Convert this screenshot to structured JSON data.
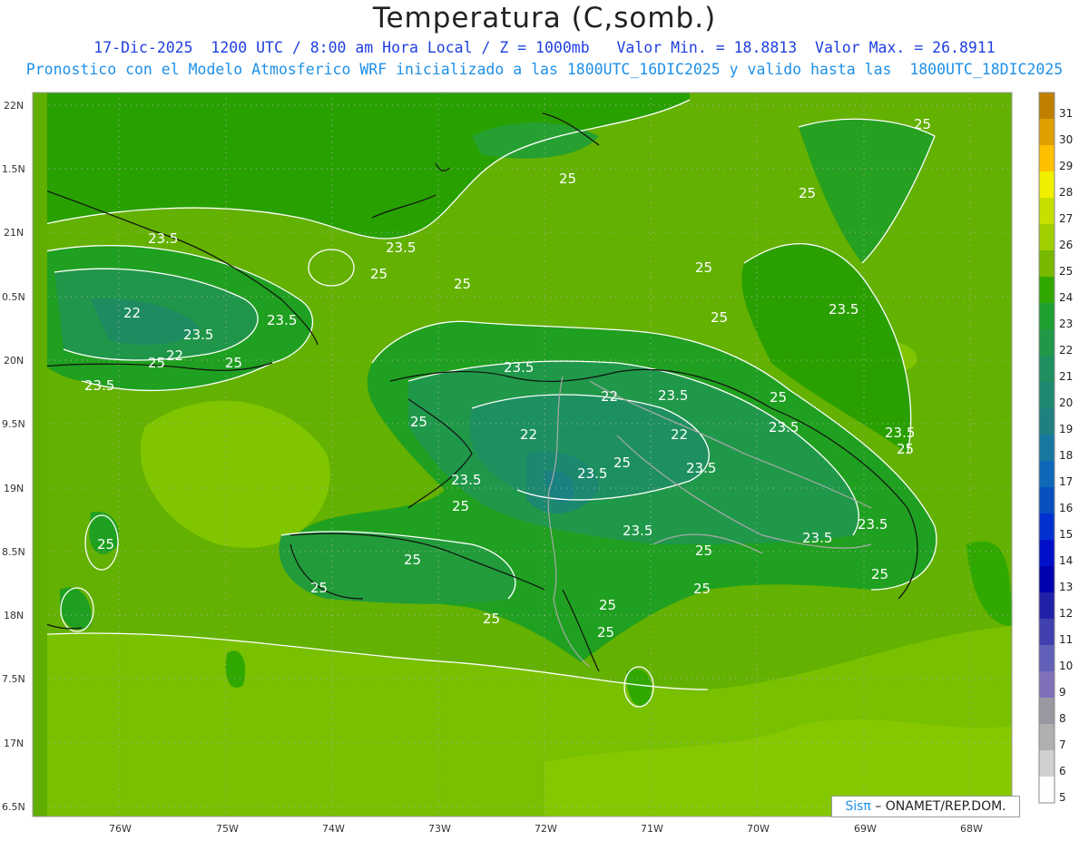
{
  "header": {
    "title": "Temperatura (C,somb.)",
    "line1": "17-Dic-2025  1200 UTC / 8:00 am Hora Local / Z = 1000mb   Valor Min. = 18.8813  Valor Max. = 26.8911",
    "line2": "Pronostico con el Modelo Atmosferico WRF inicializado a las 1800UTC_16DIC2025 y valido hasta las  1800UTC_18DIC2025"
  },
  "axes": {
    "lat_labels": [
      "22N",
      "1.5N",
      "21N",
      "0.5N",
      "20N",
      "9.5N",
      "19N",
      "8.5N",
      "18N",
      "7.5N",
      "17N",
      "6.5N"
    ],
    "lon_labels": [
      "76W",
      "75W",
      "74W",
      "73W",
      "72W",
      "71W",
      "70W",
      "69W",
      "68W"
    ]
  },
  "contour_labels": [
    "25",
    "23.5",
    "22"
  ],
  "colorbar": {
    "levels": [
      "31",
      "30",
      "29",
      "28",
      "27",
      "26",
      "25",
      "24",
      "23",
      "22",
      "21",
      "20",
      "19",
      "18",
      "17",
      "16",
      "15",
      "14",
      "13",
      "12",
      "11",
      "10",
      "9",
      "8",
      "7",
      "6",
      "5"
    ],
    "colors": [
      "#c08000",
      "#e0a000",
      "#ffc000",
      "#f0f000",
      "#c8e000",
      "#a0d000",
      "#78b800",
      "#30a800",
      "#20a030",
      "#209848",
      "#209060",
      "#208870",
      "#208080",
      "#1878a0",
      "#1068b8",
      "#0850c0",
      "#0030d0",
      "#0010c8",
      "#0000b0",
      "#2020a8",
      "#4040b0",
      "#6060b8",
      "#8070b8",
      "#9898a0",
      "#b0b0b0",
      "#d0d0d0",
      "#ffffff"
    ]
  },
  "credit": {
    "sis": "Sisπ",
    "text": " – ONAMET/REP.DOM."
  }
}
